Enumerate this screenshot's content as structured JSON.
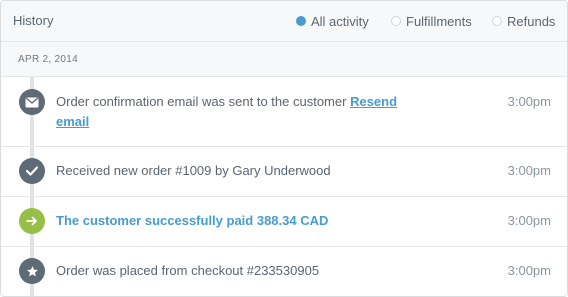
{
  "header": {
    "title": "History",
    "filters": [
      {
        "label": "All activity",
        "selected": true
      },
      {
        "label": "Fulfillments",
        "selected": false
      },
      {
        "label": "Refunds",
        "selected": false
      }
    ]
  },
  "date_group": "APR 2, 2014",
  "events": [
    {
      "icon": "envelope-icon",
      "text": "Order confirmation email was sent to the customer",
      "link": "Resend email",
      "time": "3:00pm"
    },
    {
      "icon": "checkmark-icon",
      "text": "Received new order #1009 by Gary Underwood",
      "time": "3:00pm"
    },
    {
      "icon": "arrow-right-icon",
      "text": "The customer successfully paid 388.34 CAD",
      "time": "3:00pm"
    },
    {
      "icon": "star-icon",
      "text": "Order was placed from checkout #233530905",
      "time": "3:00pm"
    }
  ],
  "colors": {
    "accent": "#479ccf",
    "icon_dark": "#5e6b74",
    "icon_green": "#96bf48"
  }
}
